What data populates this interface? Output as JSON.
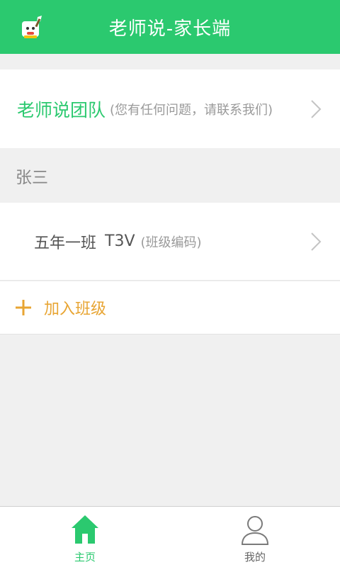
{
  "header": {
    "title": "老师说-家长端"
  },
  "team": {
    "name": "老师说团队",
    "subtitle": "(您有任何问题，请联系我们)"
  },
  "student": {
    "name": "张三"
  },
  "class_item": {
    "name": "五年一班",
    "code": "T3V",
    "code_label": "(班级编码)"
  },
  "join": {
    "label": "加入班级"
  },
  "nav": {
    "items": [
      {
        "label": "主页",
        "icon": "home-icon",
        "active": true
      },
      {
        "label": "我的",
        "icon": "user-icon",
        "active": false
      }
    ]
  },
  "colors": {
    "primary": "#2bc96f",
    "accent": "#e8a533",
    "background": "#f0f0f0"
  }
}
